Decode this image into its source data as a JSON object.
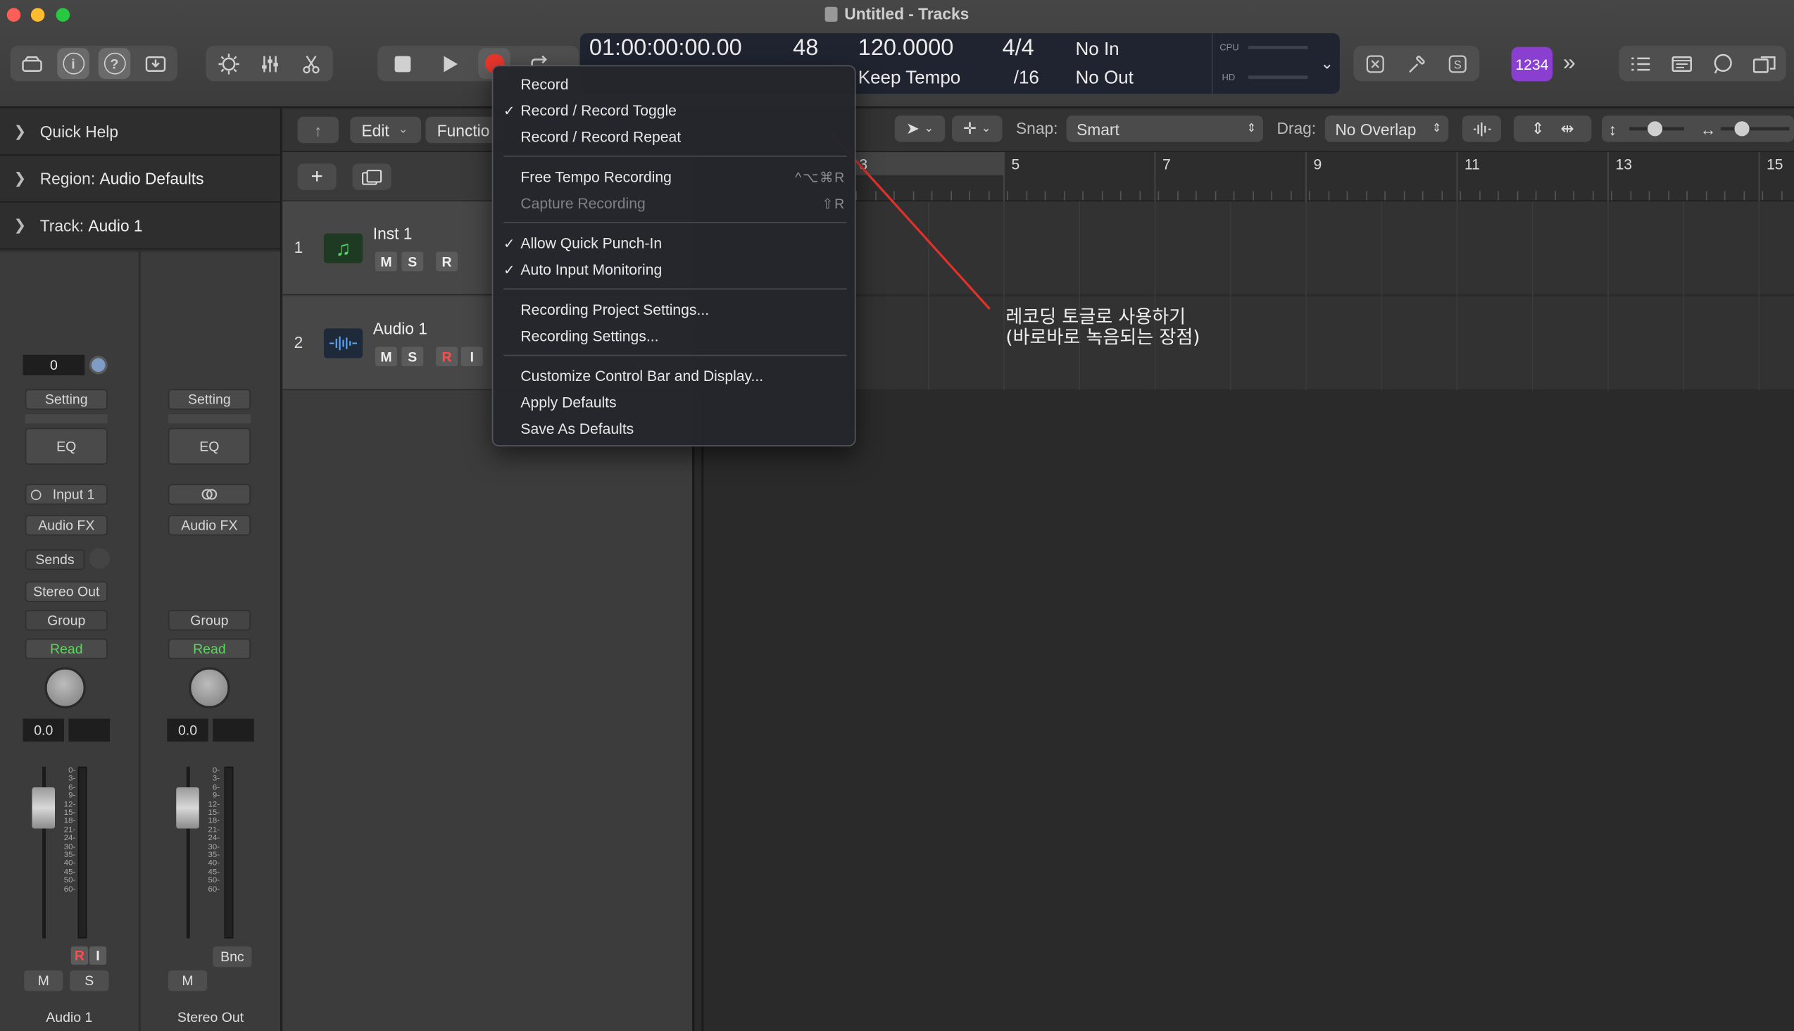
{
  "window": {
    "title": "Untitled - Tracks"
  },
  "lcd": {
    "position": "01:00:00:00.00",
    "bars": "48",
    "tempo": "120.0000",
    "tempo_mode": "Keep Tempo",
    "time_signature": "4/4",
    "division": "/16",
    "punch_in": "No In",
    "punch_out": "No Out",
    "cpu_label": "CPU",
    "hd_label": "HD"
  },
  "toolbar": {
    "count_in_badge": "1234"
  },
  "inspector": {
    "quick_help": "Quick Help",
    "region_label": "Region:",
    "region_value": "Audio Defaults",
    "track_label": "Track:",
    "track_value": "Audio 1"
  },
  "strips": [
    {
      "pan_value": "0",
      "setting": "Setting",
      "eq": "EQ",
      "input": "Input 1",
      "audio_fx": "Audio FX",
      "sends": "Sends",
      "output": "Stereo Out",
      "group": "Group",
      "automation": "Read",
      "gain": "0.0",
      "r": "R",
      "i": "I",
      "m": "M",
      "s": "S",
      "name": "Audio 1"
    },
    {
      "setting": "Setting",
      "eq": "EQ",
      "audio_fx": "Audio FX",
      "group": "Group",
      "automation": "Read",
      "gain": "0.0",
      "bnc": "Bnc",
      "m": "M",
      "name": "Stereo Out"
    }
  ],
  "fader_scale": [
    "0",
    "3",
    "6",
    "9",
    "12",
    "15",
    "18",
    "21",
    "24",
    "30",
    "35",
    "40",
    "45",
    "50",
    "60"
  ],
  "tracks_header": {
    "edit_menu": "Edit",
    "functions_menu": "Functio"
  },
  "tracks": [
    {
      "number": "1",
      "name": "Inst 1",
      "buttons": [
        "M",
        "S",
        "R"
      ]
    },
    {
      "number": "2",
      "name": "Audio 1",
      "buttons": [
        "M",
        "S",
        "R",
        "I"
      ]
    }
  ],
  "arrange_toolbar": {
    "snap_label": "Snap:",
    "snap_value": "Smart",
    "drag_label": "Drag:",
    "drag_value": "No Overlap"
  },
  "ruler": {
    "bars": [
      "3",
      "5",
      "7",
      "9",
      "11",
      "13",
      "15"
    ]
  },
  "record_menu": {
    "items": [
      {
        "label": "Record",
        "checked": false
      },
      {
        "label": "Record / Record Toggle",
        "checked": true
      },
      {
        "label": "Record / Record Repeat",
        "checked": false
      },
      {
        "label": "Free Tempo Recording",
        "shortcut": "^⌥⌘R"
      },
      {
        "label": "Capture Recording",
        "shortcut": "⇧R",
        "disabled": true
      },
      {
        "label": "Allow Quick Punch-In",
        "checked": true
      },
      {
        "label": "Auto Input Monitoring",
        "checked": true
      },
      {
        "label": "Recording Project Settings..."
      },
      {
        "label": "Recording Settings..."
      },
      {
        "label": "Customize Control Bar and Display..."
      },
      {
        "label": "Apply Defaults"
      },
      {
        "label": "Save As Defaults"
      }
    ]
  },
  "annotation": {
    "line1": "레코딩 토글로 사용하기",
    "line2": "(바로바로 녹음되는 장점)"
  },
  "colors": {
    "record": "#e8362d",
    "badge": "#8a3fd1",
    "annotation_line": "#e0312b",
    "read_green": "#5fd35f"
  }
}
